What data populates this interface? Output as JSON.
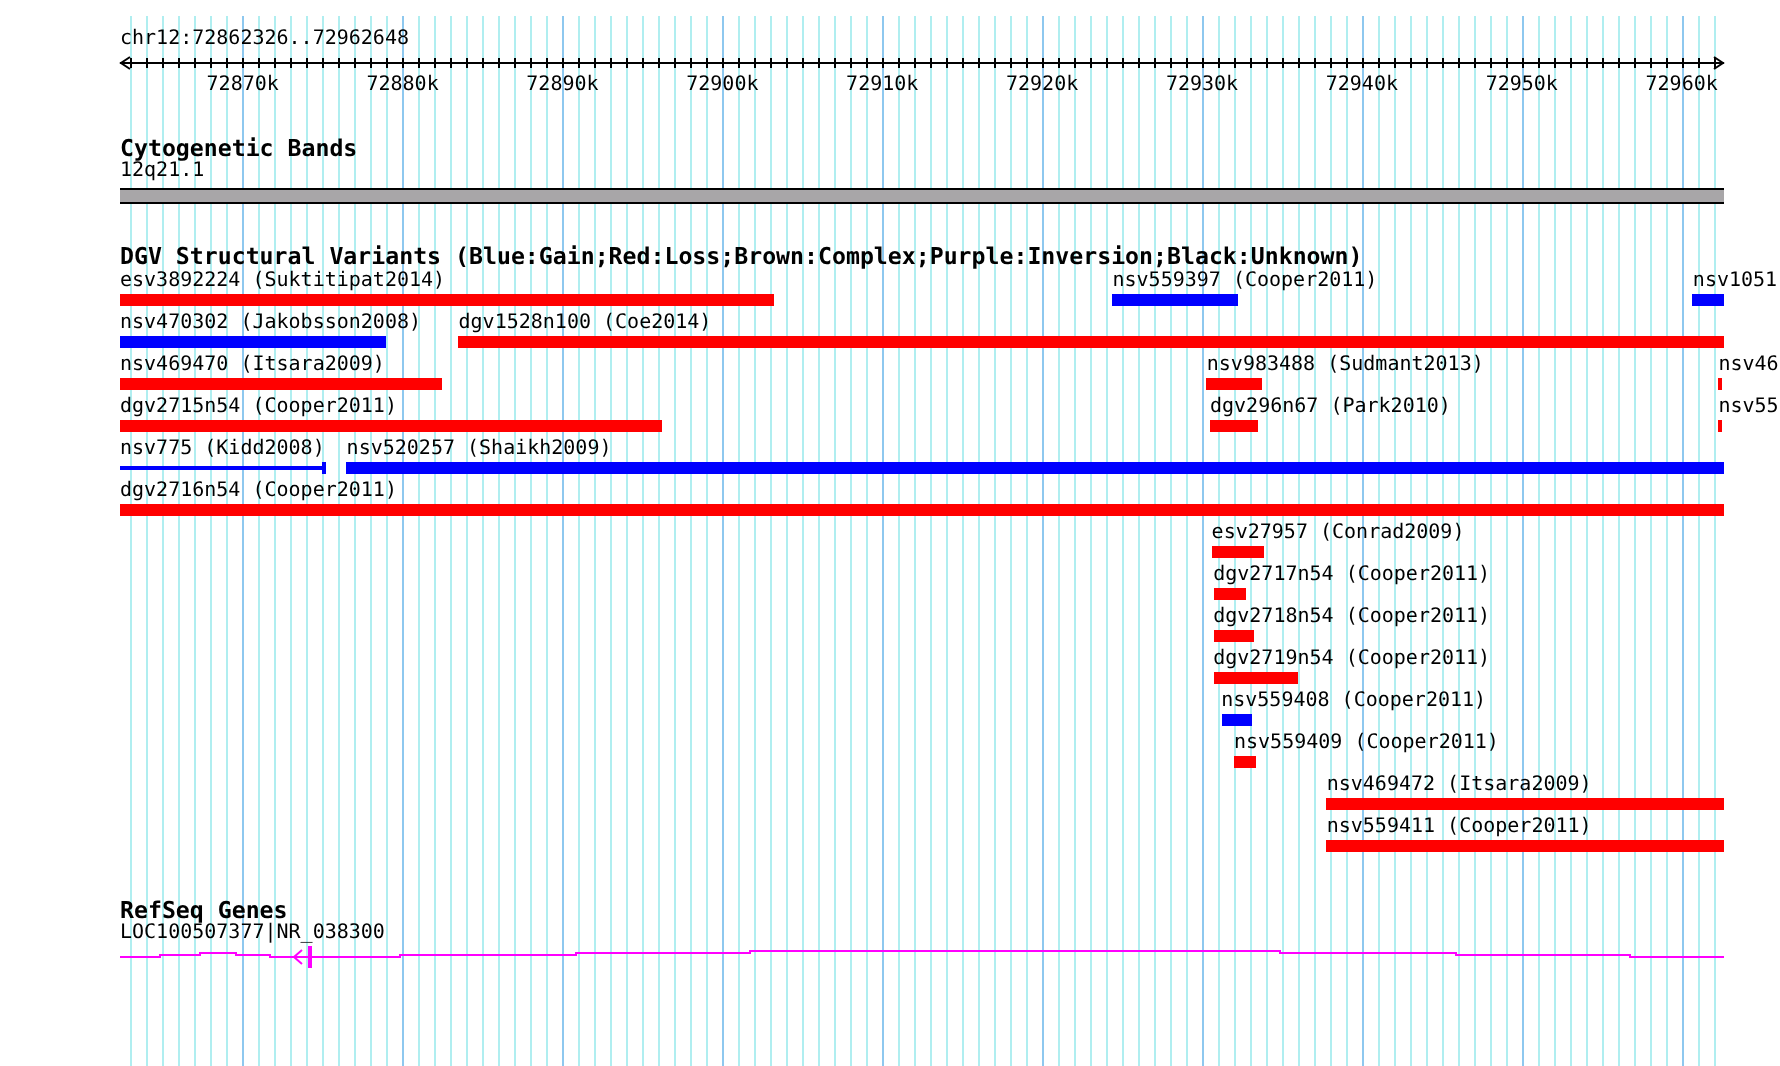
{
  "view": {
    "title": "chr12:72862326..72962648"
  },
  "ruler": {
    "ticks": [
      "72870k",
      "72880k",
      "72890k",
      "72900k",
      "72910k",
      "72920k",
      "72930k",
      "72940k",
      "72950k",
      "72960k"
    ]
  },
  "cytoband": {
    "title": "Cytogenetic Bands",
    "band": "12q21.1"
  },
  "variants": {
    "title": "DGV Structural Variants (Blue:Gain;Red:Loss;Brown:Complex;Purple:Inversion;Black:Unknown)",
    "rows": [
      [
        {
          "label": "esv3892224 (Suktitipat2014)",
          "color": "#ff0000",
          "thin": false
        },
        {
          "label": "nsv559397 (Cooper2011)",
          "color": "#0000ff",
          "thin": false
        },
        {
          "label": "nsv1051",
          "color": "#0000ff",
          "thin": false
        }
      ],
      [
        {
          "label": "nsv470302 (Jakobsson2008)",
          "color": "#0000ff",
          "thin": false
        },
        {
          "label": "dgv1528n100 (Coe2014)",
          "color": "#ff0000",
          "thin": false
        }
      ],
      [
        {
          "label": "nsv469470 (Itsara2009)",
          "color": "#ff0000",
          "thin": false
        },
        {
          "label": "nsv983488 (Sudmant2013)",
          "color": "#ff0000",
          "thin": false
        },
        {
          "label": "nsv46",
          "color": "#ff0000",
          "thin": false
        }
      ],
      [
        {
          "label": "dgv2715n54 (Cooper2011)",
          "color": "#ff0000",
          "thin": false
        },
        {
          "label": "dgv296n67 (Park2010)",
          "color": "#ff0000",
          "thin": false
        },
        {
          "label": "nsv55",
          "color": "#ff0000",
          "thin": false
        }
      ],
      [
        {
          "label": "nsv775 (Kidd2008)",
          "color": "#0000ff",
          "thin": true
        },
        {
          "label": "nsv520257 (Shaikh2009)",
          "color": "#0000ff",
          "thin": false
        }
      ],
      [
        {
          "label": "dgv2716n54 (Cooper2011)",
          "color": "#ff0000",
          "thin": false
        }
      ],
      [
        {
          "label": "esv27957 (Conrad2009)",
          "color": "#ff0000",
          "thin": false
        }
      ],
      [
        {
          "label": "dgv2717n54 (Cooper2011)",
          "color": "#ff0000",
          "thin": false
        }
      ],
      [
        {
          "label": "dgv2718n54 (Cooper2011)",
          "color": "#ff0000",
          "thin": false
        }
      ],
      [
        {
          "label": "dgv2719n54 (Cooper2011)",
          "color": "#ff0000",
          "thin": false
        }
      ],
      [
        {
          "label": "nsv559408 (Cooper2011)",
          "color": "#0000ff",
          "thin": false
        }
      ],
      [
        {
          "label": "nsv559409 (Cooper2011)",
          "color": "#ff0000",
          "thin": false
        }
      ],
      [
        {
          "label": "nsv469472 (Itsara2009)",
          "color": "#ff0000",
          "thin": false
        }
      ],
      [
        {
          "label": "nsv559411 (Cooper2011)",
          "color": "#ff0000",
          "thin": false
        }
      ]
    ]
  },
  "genes": {
    "title": "RefSeq Genes",
    "label": "LOC100507377|NR_038300"
  }
}
